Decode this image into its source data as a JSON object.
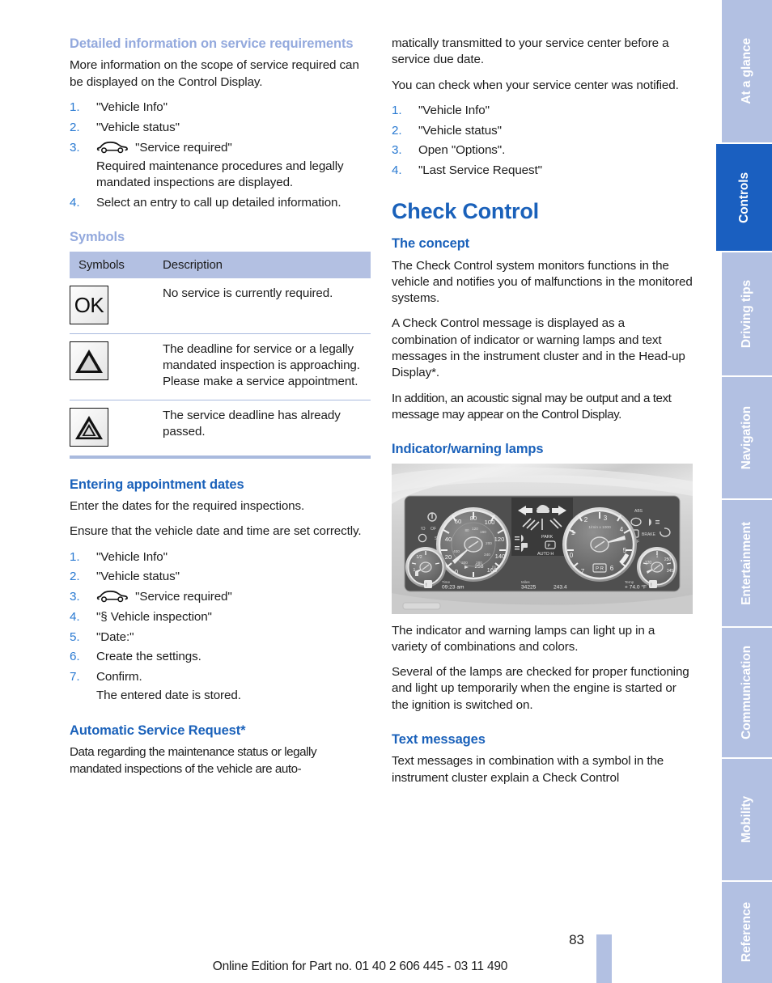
{
  "left_column": {
    "heading_1": "Detailed information on service requirements",
    "intro": "More information on the scope of service required can be displayed on the Control Display.",
    "steps_1": [
      {
        "num": "1.",
        "text": "\"Vehicle Info\""
      },
      {
        "num": "2.",
        "text": "\"Vehicle status\""
      },
      {
        "num": "3.",
        "icon": "car-icon",
        "text": "\"Service required\"",
        "sub": "Required maintenance procedures and legally mandated inspections are displayed."
      },
      {
        "num": "4.",
        "text": "Select an entry to call up detailed information."
      }
    ],
    "heading_symbols": "Symbols",
    "table": {
      "headers": [
        "Symbols",
        "Description"
      ],
      "rows": [
        {
          "symbol": "ok-badge",
          "symbol_label": "OK",
          "description": "No service is currently required."
        },
        {
          "symbol": "warning-triangle",
          "symbol_label": "",
          "description": "The deadline for service or a legally mandated inspection is approaching. Please make a service appointment."
        },
        {
          "symbol": "double-warning-triangle",
          "symbol_label": "",
          "description": "The service deadline has already passed."
        }
      ]
    },
    "heading_appointments": "Entering appointment dates",
    "appointments_p1": "Enter the dates for the required inspections.",
    "appointments_p2": "Ensure that the vehicle date and time are set correctly.",
    "steps_2": [
      {
        "num": "1.",
        "text": "\"Vehicle Info\""
      },
      {
        "num": "2.",
        "text": "\"Vehicle status\""
      },
      {
        "num": "3.",
        "icon": "car-icon",
        "text": "\"Service required\""
      },
      {
        "num": "4.",
        "text": "\"§ Vehicle inspection\""
      },
      {
        "num": "5.",
        "text": "\"Date:\""
      },
      {
        "num": "6.",
        "text": "Create the settings."
      },
      {
        "num": "7.",
        "text": "Confirm.",
        "sub": "The entered date is stored."
      }
    ],
    "heading_auto_request": "Automatic Service Request*",
    "auto_request_p1": "Data regarding the maintenance status or legally mandated inspections of the vehicle are auto-"
  },
  "right_column": {
    "continuation": "matically transmitted to your service center before a service due date.",
    "check_notified": "You can check when your service center was notified.",
    "steps_3": [
      {
        "num": "1.",
        "text": "\"Vehicle Info\""
      },
      {
        "num": "2.",
        "text": "\"Vehicle status\""
      },
      {
        "num": "3.",
        "text": "Open \"Options\"."
      },
      {
        "num": "4.",
        "text": "\"Last Service Request\""
      }
    ],
    "chapter_title": "Check Control",
    "heading_concept": "The concept",
    "concept_p1": "The Check Control system monitors functions in the vehicle and notifies you of malfunctions in the monitored systems.",
    "concept_p2": "A Check Control message is displayed as a combination of indicator or warning lamps and text messages in the instrument cluster and in the Head-up Display*.",
    "concept_p3": "In addition, an acoustic signal may be output and a text message may appear on the Control Display.",
    "heading_lamps": "Indicator/warning lamps",
    "figure_alt": "instrument-cluster-photo",
    "lamps_p1": "The indicator and warning lamps can light up in a variety of combinations and colors.",
    "lamps_p2": "Several of the lamps are checked for proper functioning and light up temporarily when the engine is started or the ignition is switched on.",
    "heading_text_messages": "Text messages",
    "text_messages_p1": "Text messages in combination with a symbol in the instrument cluster explain a Check Control"
  },
  "tab_rail": {
    "tabs": [
      {
        "label": "At a glance",
        "active": false
      },
      {
        "label": "Controls",
        "active": true
      },
      {
        "label": "Driving tips",
        "active": false
      },
      {
        "label": "Navigation",
        "active": false
      },
      {
        "label": "Entertainment",
        "active": false
      },
      {
        "label": "Communication",
        "active": false
      },
      {
        "label": "Mobility",
        "active": false
      },
      {
        "label": "Reference",
        "active": false
      }
    ]
  },
  "footer": {
    "page_number": "83",
    "edition_note": "Online Edition for Part no. 01 40 2 606 445 - 03 11 490"
  },
  "colors": {
    "heading_blue": "#1a61ba",
    "heading_faded_blue": "#93a9dd",
    "list_number_blue": "#2a7ad2",
    "tab_inactive": "#b2c0e2",
    "tab_active": "#1a5fc0",
    "table_header_bg": "#b3c0e2"
  }
}
